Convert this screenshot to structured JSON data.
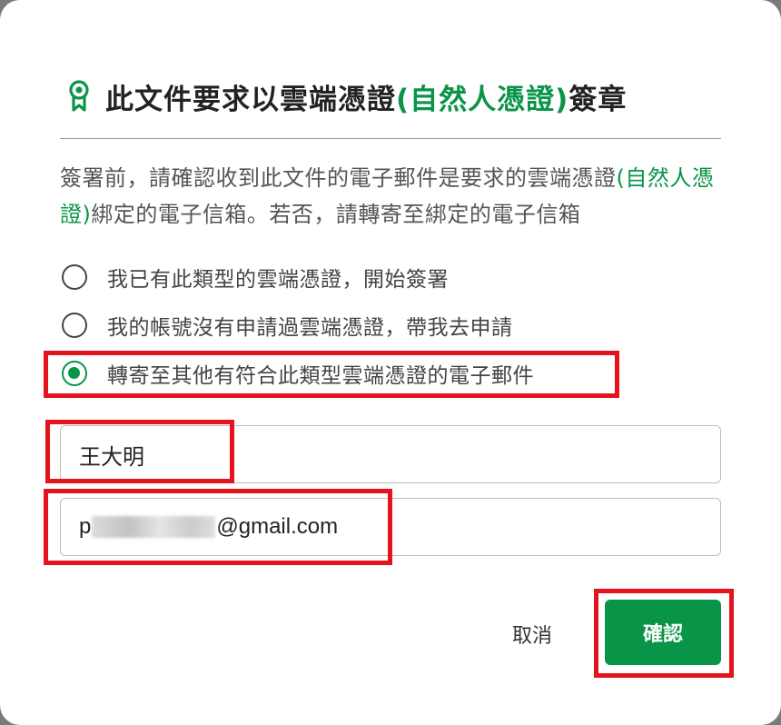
{
  "dialog": {
    "title_prefix": "此文件要求以雲端憑證",
    "title_highlight": "(自然人憑證)",
    "title_suffix": "簽章",
    "title_icon": "certificate-ribbon-icon",
    "description_part1": "簽署前，請確認收到此文件的電子郵件是要求的雲端憑證",
    "description_highlight": "(自然人憑證)",
    "description_part2": "綁定的電子信箱。若否，請轉寄至綁定的電子信箱"
  },
  "options": [
    {
      "label": "我已有此類型的雲端憑證，開始簽署",
      "selected": false
    },
    {
      "label": "我的帳號沒有申請過雲端憑證，帶我去申請",
      "selected": false
    },
    {
      "label": "轉寄至其他有符合此類型雲端憑證的電子郵件",
      "selected": true
    }
  ],
  "form": {
    "name_value": "王大明",
    "email_prefix": "p",
    "email_suffix": "@gmail.com"
  },
  "buttons": {
    "cancel": "取消",
    "confirm": "確認"
  },
  "colors": {
    "accent": "#0a9448",
    "highlight": "#e4141f"
  }
}
